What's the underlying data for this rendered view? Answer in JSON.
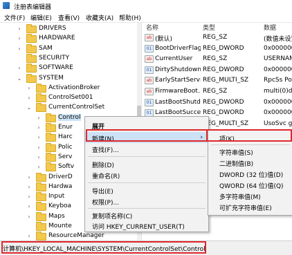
{
  "window": {
    "title": "注册表编辑器"
  },
  "menu": [
    "文件(F)",
    "编辑(E)",
    "查看(V)",
    "收藏夹(A)",
    "帮助(H)"
  ],
  "tree": [
    {
      "label": "DRIVERS",
      "indent": 36,
      "twisty": "›"
    },
    {
      "label": "HARDWARE",
      "indent": 36,
      "twisty": "›"
    },
    {
      "label": "SAM",
      "indent": 36,
      "twisty": "›"
    },
    {
      "label": "SECURITY",
      "indent": 36,
      "twisty": ""
    },
    {
      "label": "SOFTWARE",
      "indent": 36,
      "twisty": "›"
    },
    {
      "label": "SYSTEM",
      "indent": 36,
      "twisty": "⌄"
    },
    {
      "label": "ActivationBroker",
      "indent": 50,
      "twisty": "›"
    },
    {
      "label": "ControlSet001",
      "indent": 50,
      "twisty": "›"
    },
    {
      "label": "CurrentControlSet",
      "indent": 50,
      "twisty": "⌄"
    },
    {
      "label": "Control",
      "indent": 64,
      "twisty": "›",
      "selected": true
    },
    {
      "label": "Enur",
      "indent": 64,
      "twisty": "›"
    },
    {
      "label": "Harc",
      "indent": 64,
      "twisty": "›"
    },
    {
      "label": "Polic",
      "indent": 64,
      "twisty": "›"
    },
    {
      "label": "Serv",
      "indent": 64,
      "twisty": "›"
    },
    {
      "label": "Softv",
      "indent": 64,
      "twisty": "›"
    },
    {
      "label": "DriverD",
      "indent": 50,
      "twisty": "›"
    },
    {
      "label": "Hardwa",
      "indent": 50,
      "twisty": "›"
    },
    {
      "label": "Input",
      "indent": 50,
      "twisty": "›"
    },
    {
      "label": "Keyboa",
      "indent": 50,
      "twisty": "›"
    },
    {
      "label": "Maps",
      "indent": 50,
      "twisty": "›"
    },
    {
      "label": "Mounte",
      "indent": 50,
      "twisty": ""
    },
    {
      "label": "ResourceManager",
      "indent": 50,
      "twisty": "›"
    }
  ],
  "values_header": {
    "name": "名称",
    "type": "类型",
    "data": "数据"
  },
  "values": [
    {
      "icon": "ab",
      "name": "(默认)",
      "type": "REG_SZ",
      "data": "(数值未设置)"
    },
    {
      "icon": "dw",
      "name": "BootDriverFlags",
      "type": "REG_DWORD",
      "data": "0x000000"
    },
    {
      "icon": "ab",
      "name": "CurrentUser",
      "type": "REG_SZ",
      "data": "USERNAME"
    },
    {
      "icon": "dw",
      "name": "DirtyShutdown...",
      "type": "REG_DWORD",
      "data": "0x000000"
    },
    {
      "icon": "ab",
      "name": "EarlyStartServi...",
      "type": "REG_MULTI_SZ",
      "data": "RpcSs Pow"
    },
    {
      "icon": "ab",
      "name": "FirmwareBoot...",
      "type": "REG_SZ",
      "data": "multi(0)dis"
    },
    {
      "icon": "dw",
      "name": "LastBootShutd...",
      "type": "REG_DWORD",
      "data": "0x000000"
    },
    {
      "icon": "dw",
      "name": "LastBootSucce...",
      "type": "REG_DWORD",
      "data": "0x000000"
    },
    {
      "icon": "ab",
      "name": "",
      "type": "REG_MULTI_SZ",
      "data": "UsoSvc gp"
    }
  ],
  "context_menu": {
    "expand": "展开",
    "new": "新建(N)",
    "find": "查找(F)...",
    "delete": "删除(D)",
    "rename": "重命名(R)",
    "export": "导出(E)",
    "permissions": "权限(P)...",
    "copy_key_name": "复制项名称(C)",
    "goto_hkcu": "访问 HKEY_CURRENT_USER(T)"
  },
  "submenu": {
    "key": "项(K)",
    "string": "字符串值(S)",
    "binary": "二进制值(B)",
    "dword": "DWORD (32 位)值(D)",
    "qword": "QWORD (64 位)值(Q)",
    "multi_string": "多字符串值(M)",
    "expandable_string": "可扩充字符串值(E)"
  },
  "status_path": "计算机\\HKEY_LOCAL_MACHINE\\SYSTEM\\CurrentControlSet\\Control",
  "accent": "#e0262b"
}
